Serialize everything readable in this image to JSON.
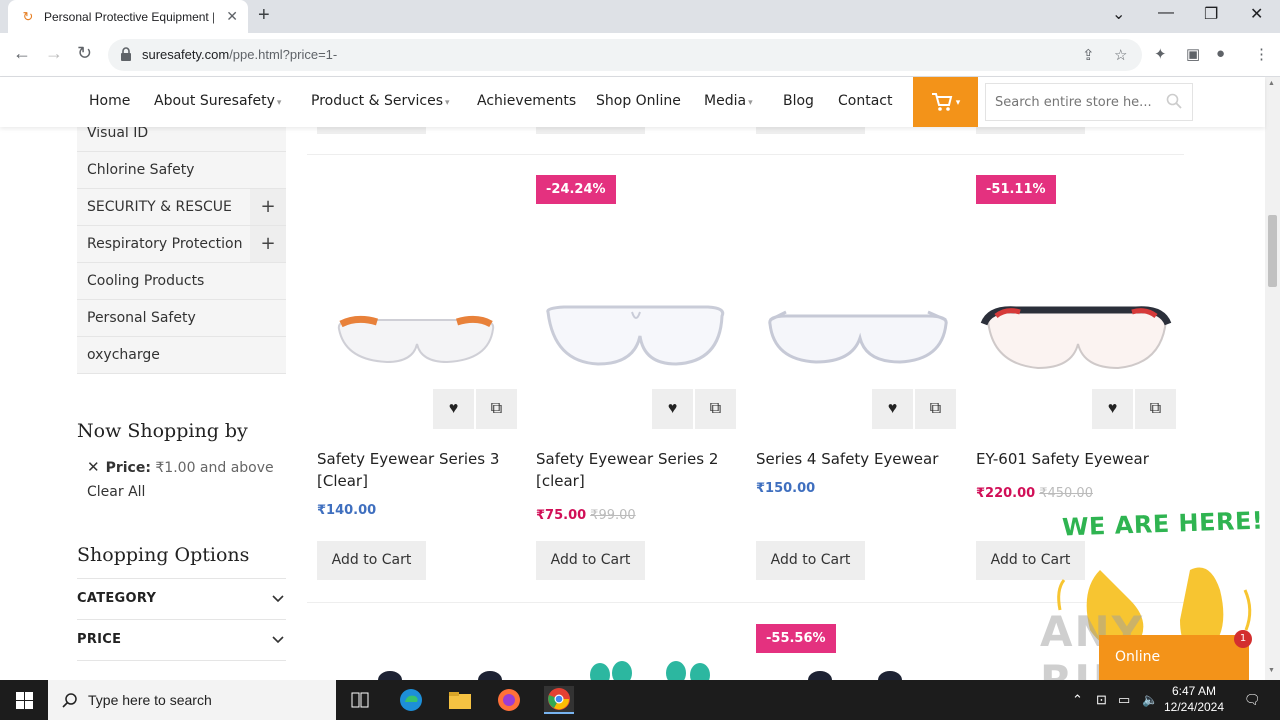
{
  "browser": {
    "tab_title": "Personal Protective Equipment |",
    "url_host": "suresafety.com",
    "url_path": "/ppe.html?price=1-"
  },
  "nav": {
    "items": [
      "Home",
      "About Suresafety",
      "Product & Services",
      "Achievements",
      "Shop Online",
      "Media",
      "Blog",
      "Contact"
    ],
    "search_placeholder": "Search entire store he..."
  },
  "sidebar": {
    "categories": [
      "Visual ID",
      "Chlorine Safety",
      "SECURITY & RESCUE",
      "Respiratory Protection",
      "Cooling Products",
      "Personal Safety",
      "oxycharge"
    ],
    "now_shopping_title": "Now Shopping by",
    "filter_label": "Price:",
    "filter_value": "₹1.00 and above",
    "clear_all": "Clear All",
    "shopping_options_title": "Shopping Options",
    "options": [
      "CATEGORY",
      "PRICE"
    ]
  },
  "products": [
    {
      "name": "Safety Eyewear Series 3 [Clear]",
      "price": "₹140.00",
      "old_price": "",
      "badge": "",
      "button": "Add to Cart"
    },
    {
      "name": "Safety Eyewear Series 2 [clear]",
      "price": "₹75.00",
      "old_price": "₹99.00",
      "badge": "-24.24%",
      "button": "Add to Cart"
    },
    {
      "name": "Series 4 Safety Eyewear",
      "price": "₹150.00",
      "old_price": "",
      "badge": "",
      "button": "Add to Cart"
    },
    {
      "name": "EY-601 Safety Eyewear",
      "price": "₹220.00",
      "old_price": "₹450.00",
      "badge": "-51.11%",
      "button": "Add to Cart"
    }
  ],
  "next_row_badge": "-55.56%",
  "chat": {
    "headline": "WE ARE HERE!",
    "status": "Online",
    "notification_count": "1"
  },
  "watermark": "ANY RUN",
  "taskbar": {
    "search_placeholder": "Type here to search",
    "time": "6:47 AM",
    "date": "12/24/2024"
  },
  "colors": {
    "accent": "#f39319",
    "badge": "#e4317f",
    "sale_price": "#d10f57",
    "regular_price": "#3f6fbf"
  }
}
